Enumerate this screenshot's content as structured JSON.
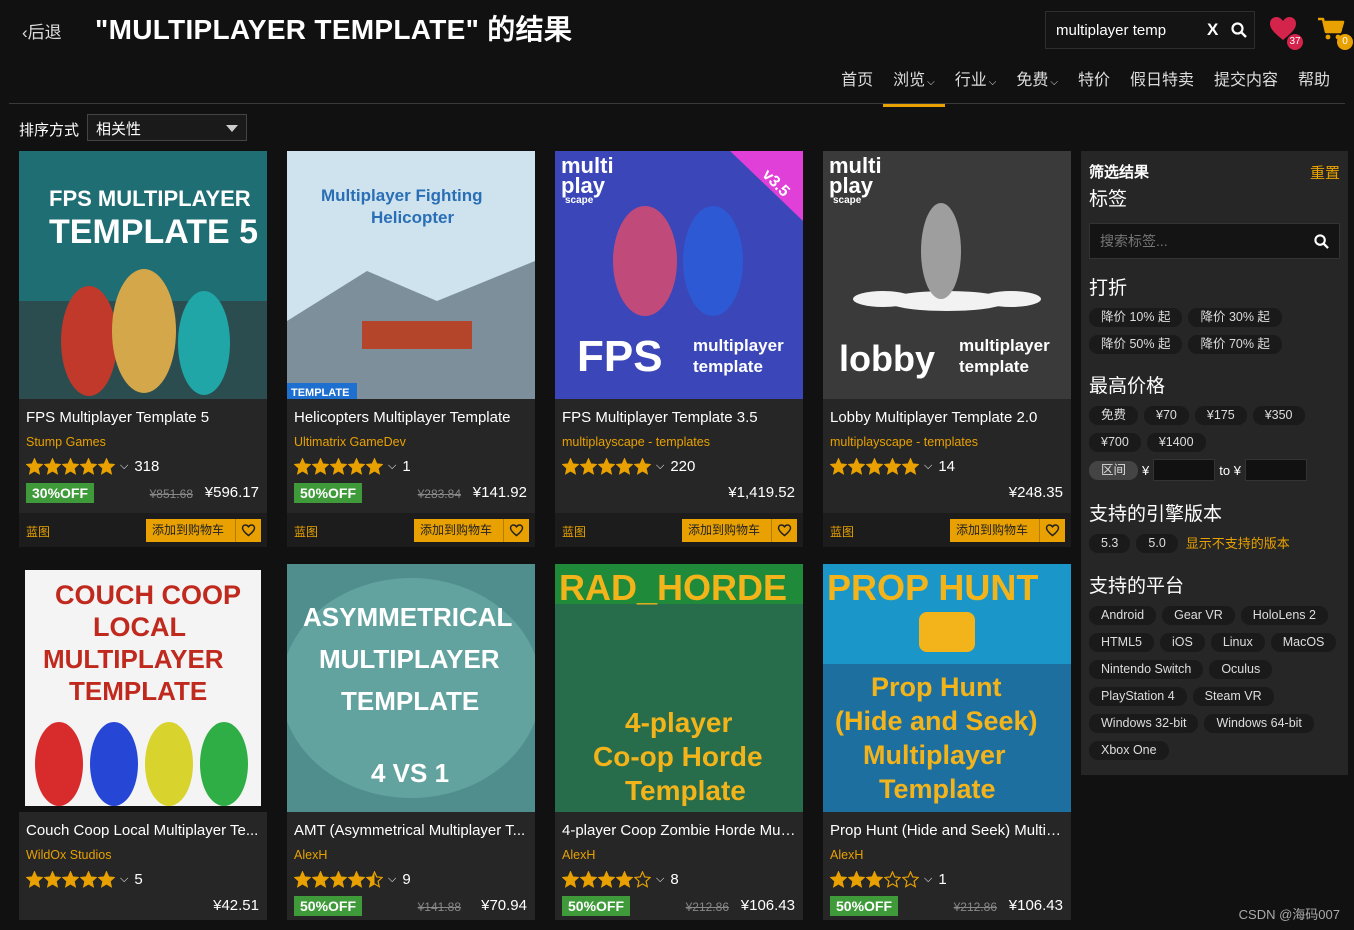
{
  "header": {
    "back_label": "‹后退",
    "title": "\"MULTIPLAYER TEMPLATE\" 的结果",
    "search_value": "multiplayer temp",
    "clear_label": "X",
    "wishlist_count": "37",
    "cart_count": "0"
  },
  "nav": [
    {
      "label": "首页",
      "chevron": false
    },
    {
      "label": "浏览",
      "chevron": true,
      "active": true
    },
    {
      "label": "行业",
      "chevron": true
    },
    {
      "label": "免费",
      "chevron": true
    },
    {
      "label": "特价",
      "chevron": false
    },
    {
      "label": "假日特卖",
      "chevron": false
    },
    {
      "label": "提交内容",
      "chevron": false
    },
    {
      "label": "帮助",
      "chevron": false
    }
  ],
  "sort": {
    "label": "排序方式",
    "value": "相关性"
  },
  "product_labels": {
    "blueprint": "蓝图",
    "add_to_cart": "添加到购物车"
  },
  "products": [
    {
      "title": "FPS Multiplayer Template 5",
      "publisher": "Stump Games",
      "stars": 5,
      "reviews": "318",
      "discount": "30%OFF",
      "old_price": "¥851.68",
      "price": "¥596.17",
      "thumb_text": [
        "FPS MULTIPLAYER",
        "TEMPLATE 5"
      ]
    },
    {
      "title": "Helicopters Multiplayer Template",
      "publisher": "Ultimatrix GameDev",
      "stars": 5,
      "reviews": "1",
      "discount": "50%OFF",
      "old_price": "¥283.84",
      "price": "¥141.92",
      "thumb_text": [
        "Multiplayer Fighting",
        "Helicopter",
        "TEMPLATE"
      ]
    },
    {
      "title": "FPS Multiplayer Template 3.5",
      "publisher": "multiplayscape - templates",
      "stars": 5,
      "reviews": "220",
      "discount": "",
      "old_price": "",
      "price": "¥1,419.52",
      "thumb_text": [
        "multi",
        "play",
        "scape",
        "v3.5",
        "FPS",
        "multiplayer",
        "template"
      ]
    },
    {
      "title": "Lobby Multiplayer Template 2.0",
      "publisher": "multiplayscape - templates",
      "stars": 5,
      "reviews": "14",
      "discount": "",
      "old_price": "",
      "price": "¥248.35",
      "thumb_text": [
        "multi",
        "play",
        "scape",
        "lobby",
        "multiplayer",
        "template"
      ]
    },
    {
      "title": "Couch Coop Local Multiplayer Te...",
      "publisher": "WildOx Studios",
      "stars": 5,
      "reviews": "5",
      "discount": "",
      "old_price": "",
      "price": "¥42.51",
      "thumb_text": [
        "COUCH COOP",
        "LOCAL",
        "MULTIPLAYER",
        "TEMPLATE"
      ]
    },
    {
      "title": "AMT (Asymmetrical Multiplayer T...",
      "publisher": "AlexH",
      "stars": 4.5,
      "reviews": "9",
      "discount": "50%OFF",
      "old_price": "¥141.88",
      "price": "¥70.94",
      "thumb_text": [
        "ASYMMETRICAL",
        "MULTIPLAYER",
        "TEMPLATE",
        "4 VS 1"
      ]
    },
    {
      "title": "4-player Coop Zombie Horde Mul...",
      "publisher": "AlexH",
      "stars": 4,
      "reviews": "8",
      "discount": "50%OFF",
      "old_price": "¥212.86",
      "price": "¥106.43",
      "thumb_text": [
        "RAD_HORDE",
        "4-player",
        "Co-op Horde",
        "Template"
      ]
    },
    {
      "title": "Prop Hunt (Hide and Seek) Multip...",
      "publisher": "AlexH",
      "stars": 3,
      "reviews": "1",
      "discount": "50%OFF",
      "old_price": "¥212.86",
      "price": "¥106.43",
      "thumb_text": [
        "PROP HUNT",
        "Prop Hunt",
        "(Hide and Seek)",
        "Multiplayer",
        "Template"
      ]
    }
  ],
  "filter": {
    "heading": "筛选结果",
    "reset": "重置",
    "tags_title": "标签",
    "tags_placeholder": "搜索标签...",
    "discount_title": "打折",
    "discounts": [
      "降价 10% 起",
      "降价 30% 起",
      "降价 50% 起",
      "降价 70% 起"
    ],
    "price_title": "最高价格",
    "prices": [
      "免费",
      "¥70",
      "¥175",
      "¥350",
      "¥700",
      "¥1400"
    ],
    "range_label": "区间",
    "range_from": "¥",
    "range_to": "to ¥",
    "engine_title": "支持的引擎版本",
    "engines": [
      "5.3",
      "5.0"
    ],
    "engine_link": "显示不支持的版本",
    "platform_title": "支持的平台",
    "platforms": [
      "Android",
      "Gear VR",
      "HoloLens 2",
      "HTML5",
      "iOS",
      "Linux",
      "MacOS",
      "Nintendo Switch",
      "Oculus",
      "PlayStation 4",
      "Steam VR",
      "Windows 32-bit",
      "Windows 64-bit",
      "Xbox One"
    ]
  },
  "watermark": "CSDN @海码007",
  "colors": {
    "accent": "#e8a100",
    "discount_green": "#3f9a3a",
    "panel": "#262626",
    "background": "#111111"
  }
}
